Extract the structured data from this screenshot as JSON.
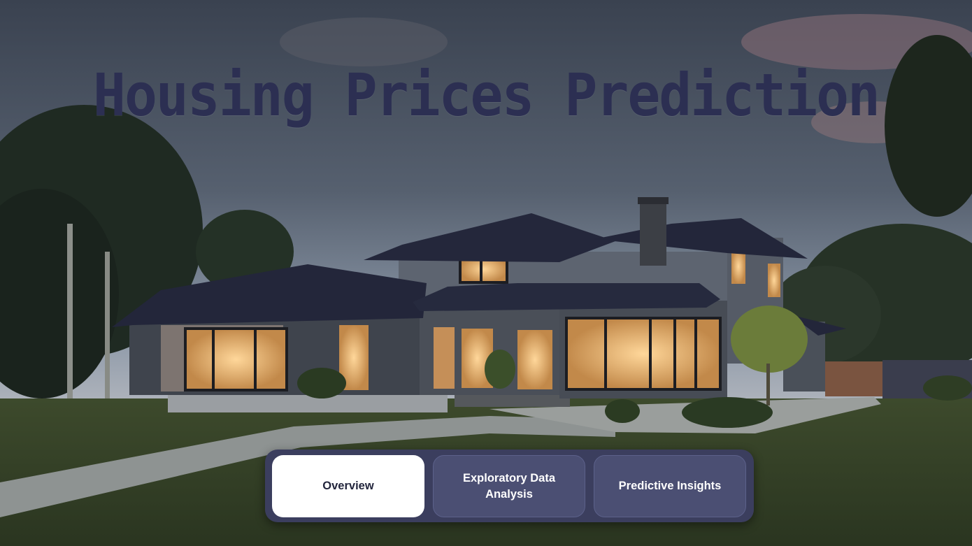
{
  "page": {
    "title": "Housing Prices Prediction"
  },
  "nav": {
    "items": [
      {
        "label": "Overview",
        "active": true
      },
      {
        "label": "Exploratory Data Analysis",
        "active": false
      },
      {
        "label": "Predictive Insights",
        "active": false
      }
    ]
  },
  "colors": {
    "title": "#2c2f52",
    "nav_background": "#3b3e5e",
    "nav_active": "#ffffff",
    "nav_inactive": "#4b4f73"
  }
}
